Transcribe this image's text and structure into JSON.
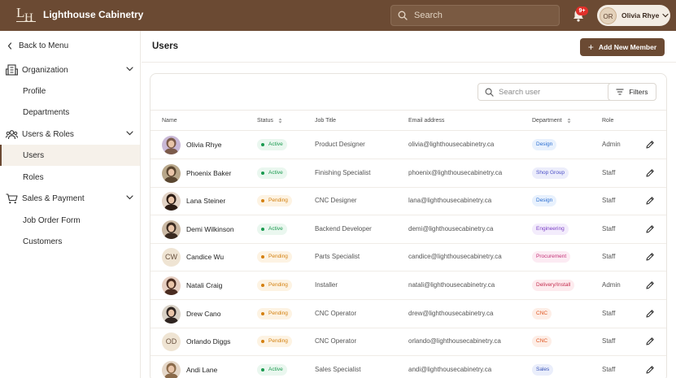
{
  "app": {
    "brand": "Lighthouse Cabinetry",
    "logo_l": "L",
    "logo_h": "H",
    "search_placeholder": "Search",
    "notifications": "9+",
    "user_initials": "OR",
    "user_name": "Olivia Rhye"
  },
  "sidebar": {
    "back": "Back to Menu",
    "groups": [
      {
        "label": "Organization",
        "items": [
          "Profile",
          "Departments"
        ]
      },
      {
        "label": "Users & Roles",
        "items": [
          "Users",
          "Roles"
        ]
      },
      {
        "label": "Sales & Payment",
        "items": [
          "Job Order Form",
          "Customers"
        ]
      }
    ],
    "active": "Users"
  },
  "main": {
    "title": "Users",
    "add_button": "Add New Member",
    "search_placeholder": "Search user",
    "filters_label": "Filters",
    "columns": [
      "Name",
      "Status",
      "Job Title",
      "Email address",
      "Department",
      "Role"
    ],
    "rows": [
      {
        "name": "Olivia Rhye",
        "status": "Active",
        "job": "Product Designer",
        "email": "olivia@lighthousecabinetry.ca",
        "dept": "Design",
        "role": "Admin",
        "avatar": "photo"
      },
      {
        "name": "Phoenix Baker",
        "status": "Active",
        "job": "Finishing Specialist",
        "email": "phoenix@lighthousecabinetry.ca",
        "dept": "Shop Group",
        "role": "Staff",
        "avatar": "photo"
      },
      {
        "name": "Lana Steiner",
        "status": "Pending",
        "job": "CNC Designer",
        "email": "lana@lighthousecabinetry.ca",
        "dept": "Design",
        "role": "Staff",
        "avatar": "photo"
      },
      {
        "name": "Demi Wilkinson",
        "status": "Active",
        "job": "Backend Developer",
        "email": "demi@lighthousecabinetry.ca",
        "dept": "Engineering",
        "role": "Staff",
        "avatar": "photo"
      },
      {
        "name": "Candice Wu",
        "status": "Pending",
        "job": "Parts Specialist",
        "email": "candice@lighthousecabinetry.ca",
        "dept": "Procurement",
        "role": "Staff",
        "avatar": "CW"
      },
      {
        "name": "Natali Craig",
        "status": "Pending",
        "job": "Installer",
        "email": "natali@lighthousecabinetry.ca",
        "dept": "Delivery/Install",
        "role": "Admin",
        "avatar": "photo"
      },
      {
        "name": "Drew Cano",
        "status": "Pending",
        "job": "CNC Operator",
        "email": "drew@lighthousecabinetry.ca",
        "dept": "CNC",
        "role": "Staff",
        "avatar": "photo"
      },
      {
        "name": "Orlando Diggs",
        "status": "Pending",
        "job": "CNC Operator",
        "email": "orlando@lighthousecabinetry.ca",
        "dept": "CNC",
        "role": "Staff",
        "avatar": "OD"
      },
      {
        "name": "Andi Lane",
        "status": "Active",
        "job": "Sales Specialist",
        "email": "andi@lighthousecabinetry.ca",
        "dept": "Sales",
        "role": "Staff",
        "avatar": "photo"
      }
    ]
  },
  "colors": {
    "brand": "#6b4a33",
    "active_text": "#1a9a4f",
    "active_bg": "#eaf7ef",
    "pending_text": "#d4800f",
    "pending_bg": "#fdf3e3"
  },
  "dept_colors": {
    "Design": {
      "fg": "#2c6fd1",
      "bg": "#e8f1fd"
    },
    "Shop Group": {
      "fg": "#4b4fc7",
      "bg": "#ecedfb"
    },
    "Engineering": {
      "fg": "#7a3fc4",
      "bg": "#f3ecfc"
    },
    "Procurement": {
      "fg": "#c4357a",
      "bg": "#fcebf3"
    },
    "Delivery/Install": {
      "fg": "#c42d4f",
      "bg": "#fdebee"
    },
    "CNC": {
      "fg": "#e0541f",
      "bg": "#fdeee7"
    },
    "Sales": {
      "fg": "#3b55b9",
      "bg": "#eaeefb"
    }
  }
}
